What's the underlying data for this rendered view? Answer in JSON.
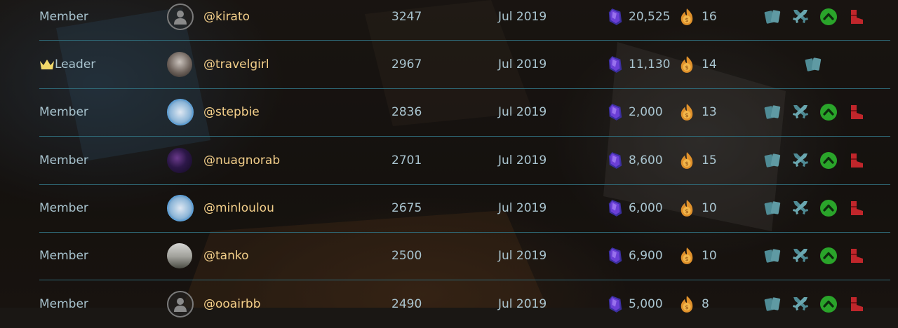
{
  "colors": {
    "role_text": "#a9c4cf",
    "username": "#f3cf8a",
    "divider": "#2f6a78",
    "cards_icon": "#4f8b95",
    "swords_icon": "#4f8b95",
    "promote_icon": "#2aa42a",
    "kick_icon": "#c0262b",
    "crown_icon": "#f1d86a",
    "gem": "#5c2fb8",
    "coin": "#e0912b"
  },
  "members": [
    {
      "role": "Member",
      "is_leader": false,
      "avatar": "default-avatar",
      "username": "@kirato",
      "rep": "3247",
      "joined": "Jul 2019",
      "gems": "20,525",
      "coins": "16"
    },
    {
      "role": "Leader",
      "is_leader": true,
      "avatar": "photo-avatar",
      "username": "@travelgirl",
      "rep": "2967",
      "joined": "Jul 2019",
      "gems": "11,130",
      "coins": "14"
    },
    {
      "role": "Member",
      "is_leader": false,
      "avatar": "cartoon-avatar",
      "username": "@stepbie",
      "rep": "2836",
      "joined": "Jul 2019",
      "gems": "2,000",
      "coins": "13"
    },
    {
      "role": "Member",
      "is_leader": false,
      "avatar": "galaxy-avatar",
      "username": "@nuagnorab",
      "rep": "2701",
      "joined": "Jul 2019",
      "gems": "8,600",
      "coins": "15"
    },
    {
      "role": "Member",
      "is_leader": false,
      "avatar": "cartoon-avatar",
      "username": "@minloulou",
      "rep": "2675",
      "joined": "Jul 2019",
      "gems": "6,000",
      "coins": "10"
    },
    {
      "role": "Member",
      "is_leader": false,
      "avatar": "landscape-avatar",
      "username": "@tanko",
      "rep": "2500",
      "joined": "Jul 2019",
      "gems": "6,900",
      "coins": "10"
    },
    {
      "role": "Member",
      "is_leader": false,
      "avatar": "default-avatar",
      "username": "@ooairbb",
      "rep": "2490",
      "joined": "Jul 2019",
      "gems": "5,000",
      "coins": "8"
    }
  ]
}
